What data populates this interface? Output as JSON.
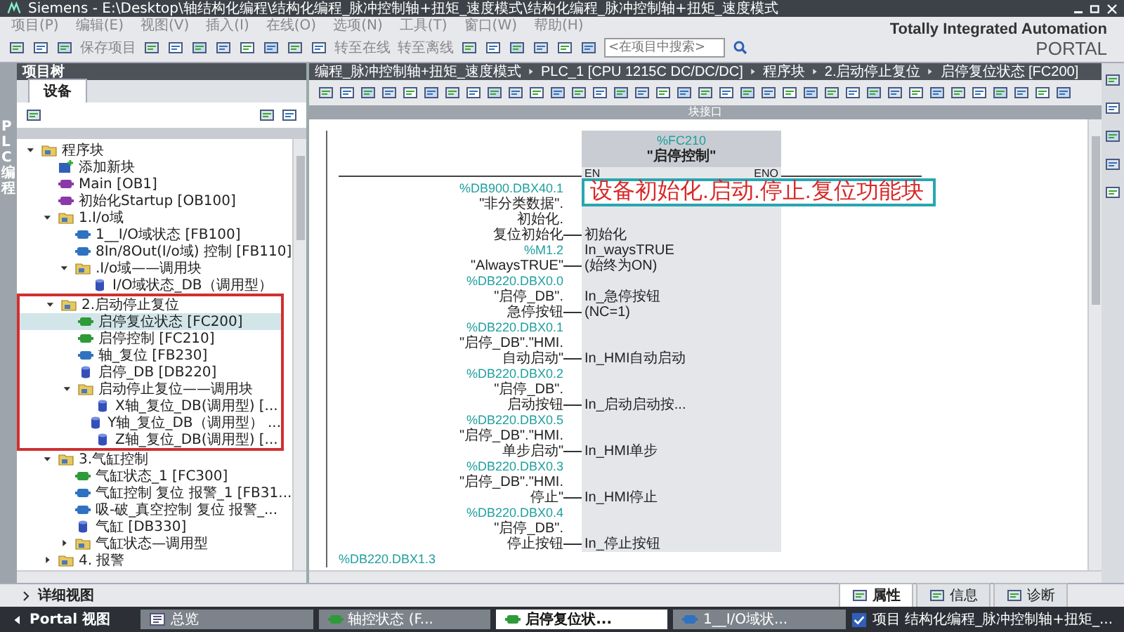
{
  "title_bar": {
    "title": "Siemens - E:\\Desktop\\轴结构化编程\\结构化编程_脉冲控制轴+扭矩_速度模式\\结构化编程_脉冲控制轴+扭矩_速度模式"
  },
  "menu": [
    "项目(P)",
    "编辑(E)",
    "视图(V)",
    "插入(I)",
    "在线(O)",
    "选项(N)",
    "工具(T)",
    "窗口(W)",
    "帮助(H)"
  ],
  "toolbar": {
    "save": "保存项目",
    "go_online": "转至在线",
    "go_offline": "转至离线",
    "search": {
      "placeholder": "<在项目中搜索>"
    }
  },
  "brand": {
    "line1": "Totally Integrated Automation",
    "line2": "PORTAL"
  },
  "project_tree": {
    "title": "项目树",
    "side_tab": "PLC 编程",
    "tab": "设备",
    "tree": [
      {
        "label": "程序块",
        "kind": "folder",
        "expanded": true,
        "highlighted": false,
        "selected": false,
        "children": [
          {
            "label": "添加新块",
            "kind": "add",
            "selected": false
          },
          {
            "label": "Main [OB1]",
            "kind": "ob",
            "selected": false
          },
          {
            "label": "初始化Startup [OB100]",
            "kind": "ob",
            "selected": false
          },
          {
            "label": "1.I/o域",
            "kind": "folder",
            "expanded": true,
            "highlighted": false,
            "selected": false,
            "children": [
              {
                "label": "1__I/O域状态 [FB100]",
                "kind": "fb",
                "selected": false
              },
              {
                "label": "8In/8Out(I/o域) 控制 [FB110]",
                "kind": "fb",
                "selected": false
              },
              {
                "label": ".I/o域——调用块",
                "kind": "folder",
                "expanded": true,
                "highlighted": false,
                "selected": false,
                "children": [
                  {
                    "label": "I/O域状态_DB（调用型）",
                    "kind": "db",
                    "selected": false
                  }
                ]
              }
            ]
          },
          {
            "label": "2.启动停止复位",
            "kind": "folder",
            "expanded": true,
            "highlighted": true,
            "selected": false,
            "children": [
              {
                "label": "启停复位状态 [FC200]",
                "kind": "fc",
                "selected": true
              },
              {
                "label": "启停控制 [FC210]",
                "kind": "fc",
                "selected": false
              },
              {
                "label": "轴_复位 [FB230]",
                "kind": "fb",
                "selected": false
              },
              {
                "label": "启停_DB [DB220]",
                "kind": "db",
                "selected": false
              },
              {
                "label": "启动停止复位——调用块",
                "kind": "folder",
                "expanded": true,
                "highlighted": false,
                "selected": false,
                "children": [
                  {
                    "label": "X轴_复位_DB(调用型) [...",
                    "kind": "db",
                    "selected": false
                  },
                  {
                    "label": "Y轴_复位_DB（调用型） ...",
                    "kind": "db",
                    "selected": false
                  },
                  {
                    "label": "Z轴_复位_DB(调用型) [...",
                    "kind": "db",
                    "selected": false
                  }
                ]
              }
            ]
          },
          {
            "label": "3.气缸控制",
            "kind": "folder",
            "expanded": true,
            "highlighted": false,
            "selected": false,
            "children": [
              {
                "label": "气缸状态_1 [FC300]",
                "kind": "fc",
                "selected": false
              },
              {
                "label": "气缸控制 复位 报警_1 [FB31...",
                "kind": "fb",
                "selected": false
              },
              {
                "label": "吸-破_真空控制 复位 报警_...",
                "kind": "fb",
                "selected": false
              },
              {
                "label": "气缸 [DB330]",
                "kind": "db",
                "selected": false
              },
              {
                "label": "气缸状态—调用型",
                "kind": "folder",
                "expanded": false,
                "highlighted": false,
                "selected": false
              }
            ]
          },
          {
            "label": "4. 报警",
            "kind": "folder",
            "expanded": false,
            "highlighted": false,
            "selected": false
          }
        ]
      }
    ]
  },
  "details_view": "详细视图",
  "breadcrumb": [
    "编程_脉冲控制轴+扭矩_速度模式",
    "PLC_1 [CPU 1215C DC/DC/DC]",
    "程序块",
    "2.启动停止复位",
    "启停复位状态 [FC200]"
  ],
  "editor": {
    "interface_bar": "块接口",
    "block": {
      "address": "%FC210",
      "name": "\"启停控制\"",
      "en": "EN",
      "eno": "ENO"
    },
    "callout": "设备初始化.启动.停止.复位功能块",
    "params": [
      {
        "address": "%DB900.DBX40.1",
        "operand": [
          "\"非分类数据\".",
          "初始化.",
          "复位初始化"
        ],
        "pin": [
          "初始化"
        ]
      },
      {
        "address": "%M1.2",
        "operand": [
          "\"AlwaysTRUE\""
        ],
        "pin": [
          "In_waysTRUE",
          "(始终为ON)"
        ]
      },
      {
        "address": "%DB220.DBX0.0",
        "operand": [
          "\"启停_DB\".",
          "急停按钮"
        ],
        "pin": [
          "In_急停按钮",
          "(NC=1)"
        ]
      },
      {
        "address": "%DB220.DBX0.1",
        "operand": [
          "\"启停_DB\".\"HMI.",
          "自动启动\""
        ],
        "pin": [
          "In_HMI自动启动"
        ]
      },
      {
        "address": "%DB220.DBX0.2",
        "operand": [
          "\"启停_DB\".",
          "启动按钮"
        ],
        "pin": [
          "In_启动启动按..."
        ]
      },
      {
        "address": "%DB220.DBX0.5",
        "operand": [
          "\"启停_DB\".\"HMI.",
          "单步启动\""
        ],
        "pin": [
          "In_HMI单步"
        ]
      },
      {
        "address": "%DB220.DBX0.3",
        "operand": [
          "\"启停_DB\".\"HMI.",
          "停止\""
        ],
        "pin": [
          "In_HMI停止"
        ]
      },
      {
        "address": "%DB220.DBX0.4",
        "operand": [
          "\"启停_DB\".",
          "停止按钮"
        ],
        "pin": [
          "In_停止按钮"
        ]
      }
    ],
    "next_address": "%DB220.DBX1.3"
  },
  "inspector_tabs": [
    {
      "label": "属性",
      "selected": true
    },
    {
      "label": "信息",
      "selected": false
    },
    {
      "label": "诊断",
      "selected": false
    }
  ],
  "taskbar": {
    "portal": "Portal 视图",
    "tabs": [
      {
        "label": "总览",
        "kind": "overview",
        "selected": false
      },
      {
        "label": "轴控状态 (F...",
        "kind": "fc",
        "selected": false
      },
      {
        "label": "启停复位状...",
        "kind": "fc",
        "selected": true
      },
      {
        "label": "1__I/O域状...",
        "kind": "fb",
        "selected": false
      }
    ],
    "status": "项目 结构化编程_脉冲控制轴+扭矩_..."
  }
}
